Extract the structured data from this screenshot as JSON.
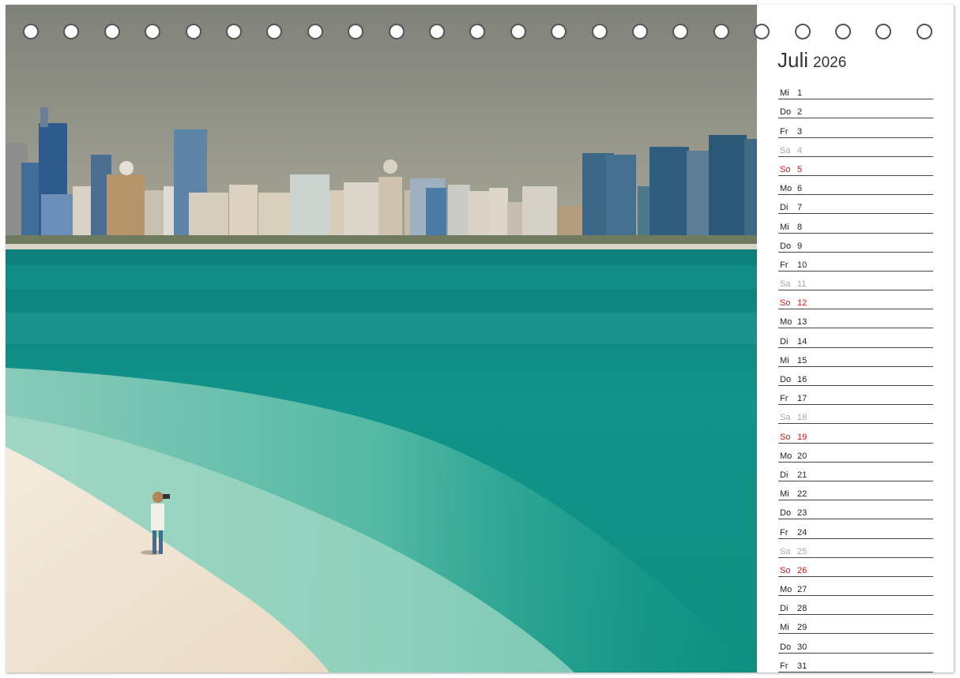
{
  "calendar": {
    "month": "Juli",
    "year": "2026",
    "colors": {
      "weekday": "#222222",
      "saturday": "#a8a8a8",
      "sunday": "#d01818"
    },
    "days": [
      {
        "wd": "Mi",
        "d": "1",
        "type": "weekday"
      },
      {
        "wd": "Do",
        "d": "2",
        "type": "weekday"
      },
      {
        "wd": "Fr",
        "d": "3",
        "type": "weekday"
      },
      {
        "wd": "Sa",
        "d": "4",
        "type": "saturday"
      },
      {
        "wd": "So",
        "d": "5",
        "type": "sunday"
      },
      {
        "wd": "Mo",
        "d": "6",
        "type": "weekday"
      },
      {
        "wd": "Di",
        "d": "7",
        "type": "weekday"
      },
      {
        "wd": "Mi",
        "d": "8",
        "type": "weekday"
      },
      {
        "wd": "Do",
        "d": "9",
        "type": "weekday"
      },
      {
        "wd": "Fr",
        "d": "10",
        "type": "weekday"
      },
      {
        "wd": "Sa",
        "d": "11",
        "type": "saturday"
      },
      {
        "wd": "So",
        "d": "12",
        "type": "sunday"
      },
      {
        "wd": "Mo",
        "d": "13",
        "type": "weekday"
      },
      {
        "wd": "Di",
        "d": "14",
        "type": "weekday"
      },
      {
        "wd": "Mi",
        "d": "15",
        "type": "weekday"
      },
      {
        "wd": "Do",
        "d": "16",
        "type": "weekday"
      },
      {
        "wd": "Fr",
        "d": "17",
        "type": "weekday"
      },
      {
        "wd": "Sa",
        "d": "18",
        "type": "saturday"
      },
      {
        "wd": "So",
        "d": "19",
        "type": "sunday"
      },
      {
        "wd": "Mo",
        "d": "20",
        "type": "weekday"
      },
      {
        "wd": "Di",
        "d": "21",
        "type": "weekday"
      },
      {
        "wd": "Mi",
        "d": "22",
        "type": "weekday"
      },
      {
        "wd": "Do",
        "d": "23",
        "type": "weekday"
      },
      {
        "wd": "Fr",
        "d": "24",
        "type": "weekday"
      },
      {
        "wd": "Sa",
        "d": "25",
        "type": "saturday"
      },
      {
        "wd": "So",
        "d": "26",
        "type": "sunday"
      },
      {
        "wd": "Mo",
        "d": "27",
        "type": "weekday"
      },
      {
        "wd": "Di",
        "d": "28",
        "type": "weekday"
      },
      {
        "wd": "Mi",
        "d": "29",
        "type": "weekday"
      },
      {
        "wd": "Do",
        "d": "30",
        "type": "weekday"
      },
      {
        "wd": "Fr",
        "d": "31",
        "type": "weekday"
      }
    ]
  },
  "binding": {
    "ring_count": 23
  },
  "photo": {
    "colors": {
      "sky": "#8c8f84",
      "sea_deep": "#0d8a82",
      "sea_shallow": "#58bfa8",
      "sand": "#efe3d2"
    }
  }
}
